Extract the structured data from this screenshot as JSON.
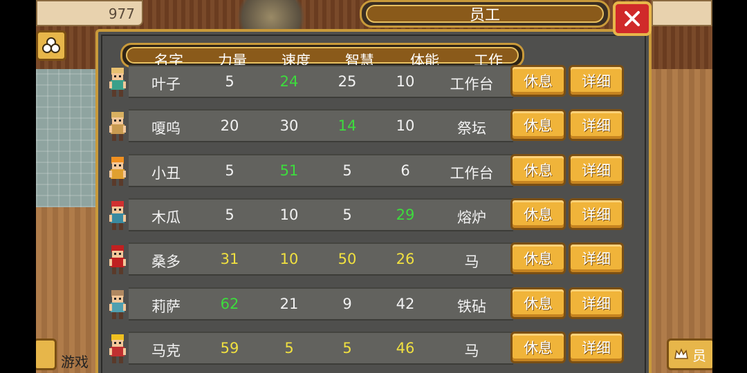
{
  "hud": {
    "gold_value": "977",
    "bottom_left_label": "游戏",
    "bottom_right_label": "员"
  },
  "dialog": {
    "title": "员工",
    "columns": [
      "名字",
      "力量",
      "速度",
      "智慧",
      "体能",
      "工作"
    ],
    "buttons": {
      "rest": "休息",
      "detail": "详细"
    }
  },
  "employees": [
    {
      "name": "叶子",
      "strength": "5",
      "speed": "24",
      "wisdom": "25",
      "stamina": "10",
      "job": "工作台",
      "colors": {
        "strength": "#f2f2f2",
        "speed": "#3ddc3d",
        "wisdom": "#f2f2f2",
        "stamina": "#f2f2f2"
      },
      "sprite": {
        "hair": "#e8c070",
        "body": "#3aa08a"
      }
    },
    {
      "name": "嗄呜",
      "strength": "20",
      "speed": "30",
      "wisdom": "14",
      "stamina": "10",
      "job": "祭坛",
      "colors": {
        "strength": "#f2f2f2",
        "speed": "#f2f2f2",
        "wisdom": "#3ddc3d",
        "stamina": "#f2f2f2"
      },
      "sprite": {
        "hair": "#d8b060",
        "body": "#c89a50"
      }
    },
    {
      "name": "小丑",
      "strength": "5",
      "speed": "51",
      "wisdom": "5",
      "stamina": "6",
      "job": "工作台",
      "colors": {
        "strength": "#f2f2f2",
        "speed": "#3ddc3d",
        "wisdom": "#f2f2f2",
        "stamina": "#f2f2f2"
      },
      "sprite": {
        "hair": "#f09020",
        "body": "#e0a030"
      }
    },
    {
      "name": "木瓜",
      "strength": "5",
      "speed": "10",
      "wisdom": "5",
      "stamina": "29",
      "job": "熔炉",
      "colors": {
        "strength": "#f2f2f2",
        "speed": "#f2f2f2",
        "wisdom": "#f2f2f2",
        "stamina": "#3ddc3d"
      },
      "sprite": {
        "hair": "#d03030",
        "body": "#3a8aa0"
      }
    },
    {
      "name": "桑多",
      "strength": "31",
      "speed": "10",
      "wisdom": "50",
      "stamina": "26",
      "job": "马",
      "colors": {
        "strength": "#f0e040",
        "speed": "#f0e040",
        "wisdom": "#f0e040",
        "stamina": "#f0e040"
      },
      "sprite": {
        "hair": "#c02020",
        "body": "#c02020"
      }
    },
    {
      "name": "莉萨",
      "strength": "62",
      "speed": "21",
      "wisdom": "9",
      "stamina": "42",
      "job": "铁砧",
      "colors": {
        "strength": "#3ddc3d",
        "speed": "#f2f2f2",
        "wisdom": "#f2f2f2",
        "stamina": "#f2f2f2"
      },
      "sprite": {
        "hair": "#b08860",
        "body": "#50a0b0"
      }
    },
    {
      "name": "马克",
      "strength": "59",
      "speed": "5",
      "wisdom": "5",
      "stamina": "46",
      "job": "马",
      "colors": {
        "strength": "#f0e040",
        "speed": "#f0e040",
        "wisdom": "#f0e040",
        "stamina": "#f0e040"
      },
      "sprite": {
        "hair": "#f0c020",
        "body": "#c03030"
      }
    }
  ]
}
